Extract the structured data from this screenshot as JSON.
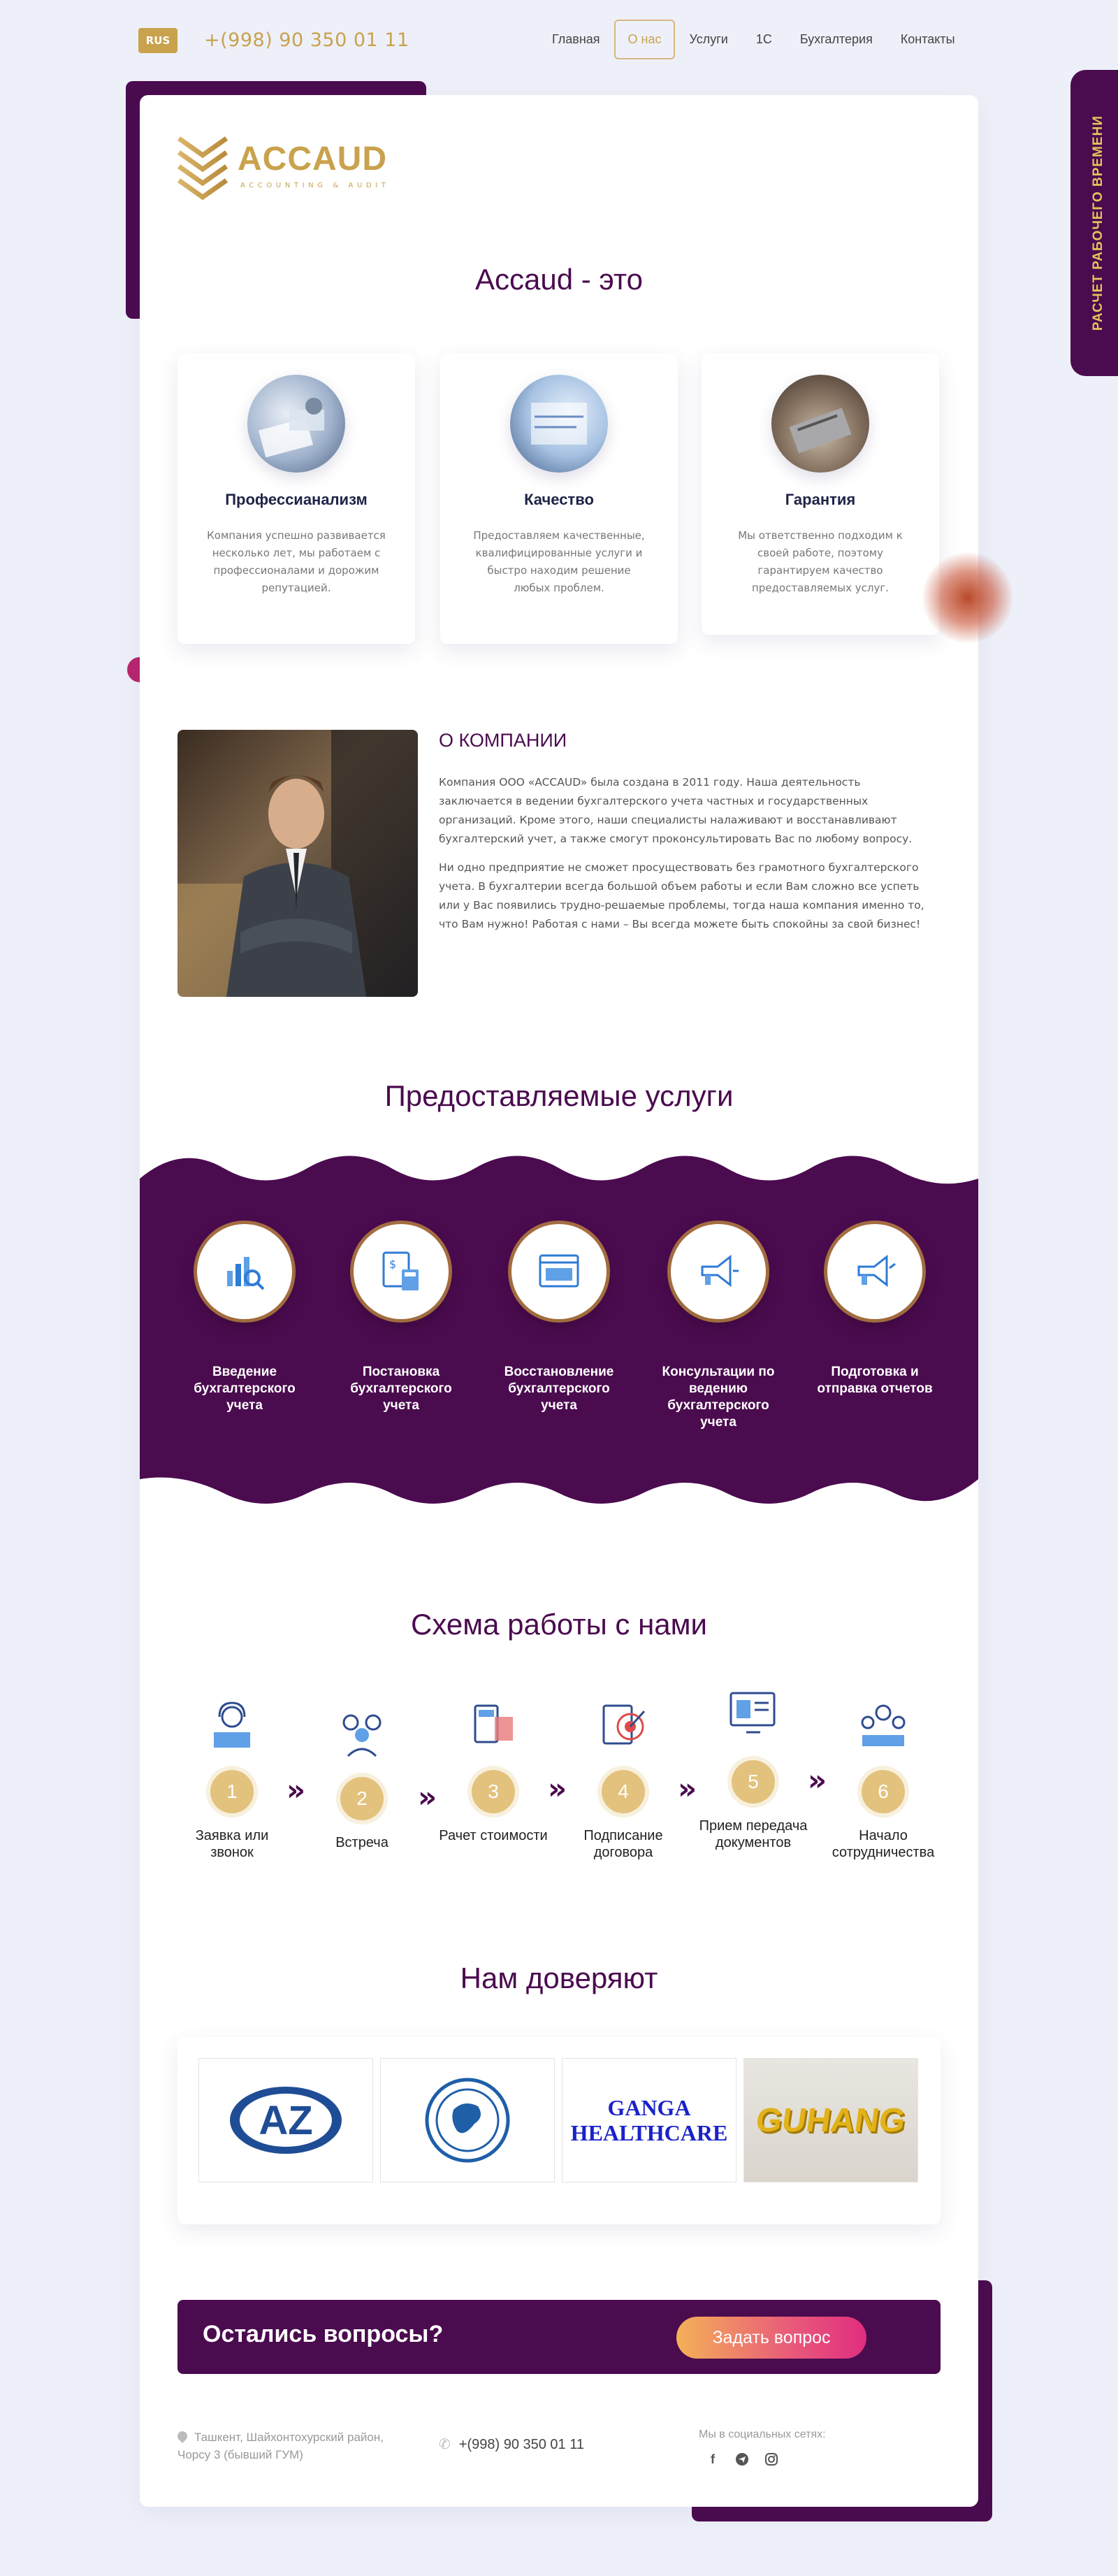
{
  "header": {
    "lang": "RUS",
    "phone": "+(998) 90 350 01 11",
    "nav": [
      "Главная",
      "О нас",
      "Услуги",
      "1С",
      "Бухгалтерия",
      "Контакты"
    ],
    "nav_active": "О нас"
  },
  "side_tab": {
    "label": "РАСЧЕТ РАБОЧЕГО ВРЕМЕНИ"
  },
  "logo": {
    "brand": "ACCAUD",
    "tagline": "ACCOUNTING & AUDIT"
  },
  "intro": {
    "title": "Accaud - это",
    "features": [
      {
        "title": "Профессианализм",
        "text": "Компания успешно развивается несколько лет, мы работаем с профессионалами и дорожим репутацией."
      },
      {
        "title": "Качество",
        "text": "Предоставляем качественные, квалифицированные услуги и быстро находим решение любых проблем."
      },
      {
        "title": "Гарантия",
        "text": "Мы ответственно подходим к своей работе, поэтому гарантируем качество предоставляемых услуг."
      }
    ]
  },
  "about": {
    "title": "О КОМПАНИИ",
    "p1": "Компания ООО «ACCAUD» была создана в 2011 году. Наша деятельность заключается в ведении бухгалтерского учета частных и государственных организаций. Кроме этого, наши специалисты налаживают и восстанавливают бухгалтерский учет, а также смогут проконсультировать Вас по любому вопросу.",
    "p2": "Ни одно предприятие не сможет просуществовать без грамотного бухгалтерского учета. В бухгалтерии всегда большой объем работы и если Вам сложно все успеть или у Вас появились трудно-решаемые проблемы, тогда наша компания именно то, что Вам нужно! Работая с нами – Вы всегда можете быть спокойны за свой бизнес!"
  },
  "services": {
    "title": "Предоставляемые услуги",
    "items": [
      {
        "label": "Введение бухгалтерского учета",
        "icon": "chart-magnifier-icon"
      },
      {
        "label": "Постановка бухгалтерского учета",
        "icon": "document-calculator-icon"
      },
      {
        "label": "Восстановление бухгалтерского учета",
        "icon": "browser-window-icon"
      },
      {
        "label": "Консультации по ведению бухгалтерского учета",
        "icon": "megaphone-icon"
      },
      {
        "label": "Подготовка и отправка отчетов",
        "icon": "megaphone-icon"
      }
    ],
    "colors": {
      "band": "#4b0b4f",
      "accent": "#f1bd3b"
    }
  },
  "process": {
    "title": "Схема работы с нами",
    "steps": [
      {
        "num": "1",
        "label": "Заявка или звонок",
        "icon": "operator-icon"
      },
      {
        "num": "2",
        "label": "Встреча",
        "icon": "meeting-icon"
      },
      {
        "num": "3",
        "label": "Рачет стоимости",
        "icon": "calculator-icon"
      },
      {
        "num": "4",
        "label": "Подписание договора",
        "icon": "target-icon"
      },
      {
        "num": "5",
        "label": "Прием передача документов",
        "icon": "document-screen-icon"
      },
      {
        "num": "6",
        "label": "Начало сотрудничества",
        "icon": "team-icon"
      }
    ],
    "arrow": "»"
  },
  "trust": {
    "title": "Нам доверяют",
    "partners": [
      {
        "name": "az-logo",
        "text": "AZ"
      },
      {
        "name": "globe-logo",
        "text": ""
      },
      {
        "name": "ganga-logo",
        "text": "GANGA HEALTHCARE"
      },
      {
        "name": "guhang-logo",
        "text": "GUHANG"
      }
    ]
  },
  "cta": {
    "question": "Остались вопросы?",
    "button": "Задать вопрос"
  },
  "footer": {
    "address": "Ташкент, Шайхонтохурский район, Чорсу 3 (бывший ГУМ)",
    "phone": "+(998) 90 350 01 11",
    "social_label": "Мы в социальных сетях:",
    "social": [
      "facebook-icon",
      "telegram-icon",
      "instagram-icon"
    ]
  }
}
